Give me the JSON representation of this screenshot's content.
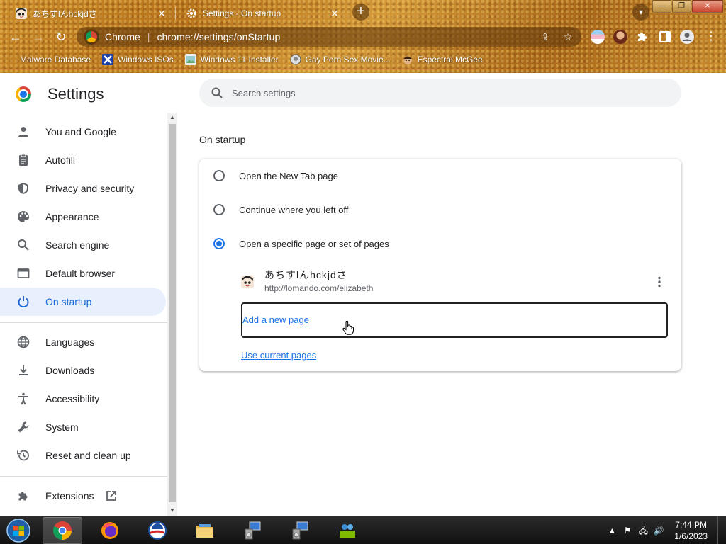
{
  "browser": {
    "tabs": [
      {
        "title": "あちすlんhckjdさ",
        "active": false
      },
      {
        "title": "Settings - On startup",
        "active": true
      }
    ],
    "omnibox": {
      "scheme_label": "Chrome",
      "url": "chrome://settings/onStartup"
    },
    "bookmarks": [
      {
        "label": "Malware Database"
      },
      {
        "label": "Windows ISOs"
      },
      {
        "label": "Windows 11 Installer"
      },
      {
        "label": "Gay Porn Sex Movie..."
      },
      {
        "label": "Espectral McGee"
      }
    ]
  },
  "settings": {
    "title": "Settings",
    "search_placeholder": "Search settings",
    "nav": {
      "group1": [
        {
          "label": "You and Google",
          "icon": "person-icon"
        },
        {
          "label": "Autofill",
          "icon": "clipboard-icon"
        },
        {
          "label": "Privacy and security",
          "icon": "shield-icon"
        },
        {
          "label": "Appearance",
          "icon": "palette-icon"
        },
        {
          "label": "Search engine",
          "icon": "search-icon"
        },
        {
          "label": "Default browser",
          "icon": "browser-window-icon"
        },
        {
          "label": "On startup",
          "icon": "power-icon",
          "active": true
        }
      ],
      "group2": [
        {
          "label": "Languages",
          "icon": "globe-icon"
        },
        {
          "label": "Downloads",
          "icon": "download-icon"
        },
        {
          "label": "Accessibility",
          "icon": "accessibility-icon"
        },
        {
          "label": "System",
          "icon": "wrench-icon"
        },
        {
          "label": "Reset and clean up",
          "icon": "history-icon"
        }
      ],
      "extensions": {
        "label": "Extensions",
        "icon": "puzzle-icon"
      }
    },
    "section_title": "On startup",
    "options": [
      {
        "label": "Open the New Tab page",
        "checked": false
      },
      {
        "label": "Continue where you left off",
        "checked": false
      },
      {
        "label": "Open a specific page or set of pages",
        "checked": true
      }
    ],
    "startup_page": {
      "title": "あちすlんhckjdさ",
      "url": "http://lomando.com/elizabeth"
    },
    "add_new_page": "Add a new page",
    "use_current_pages": "Use current pages"
  },
  "taskbar": {
    "time": "7:44 PM",
    "date": "1/6/2023"
  },
  "colors": {
    "accent": "#1a73e8",
    "nav_active_bg": "#e8f0fe",
    "nav_active_text": "#1967d2"
  }
}
